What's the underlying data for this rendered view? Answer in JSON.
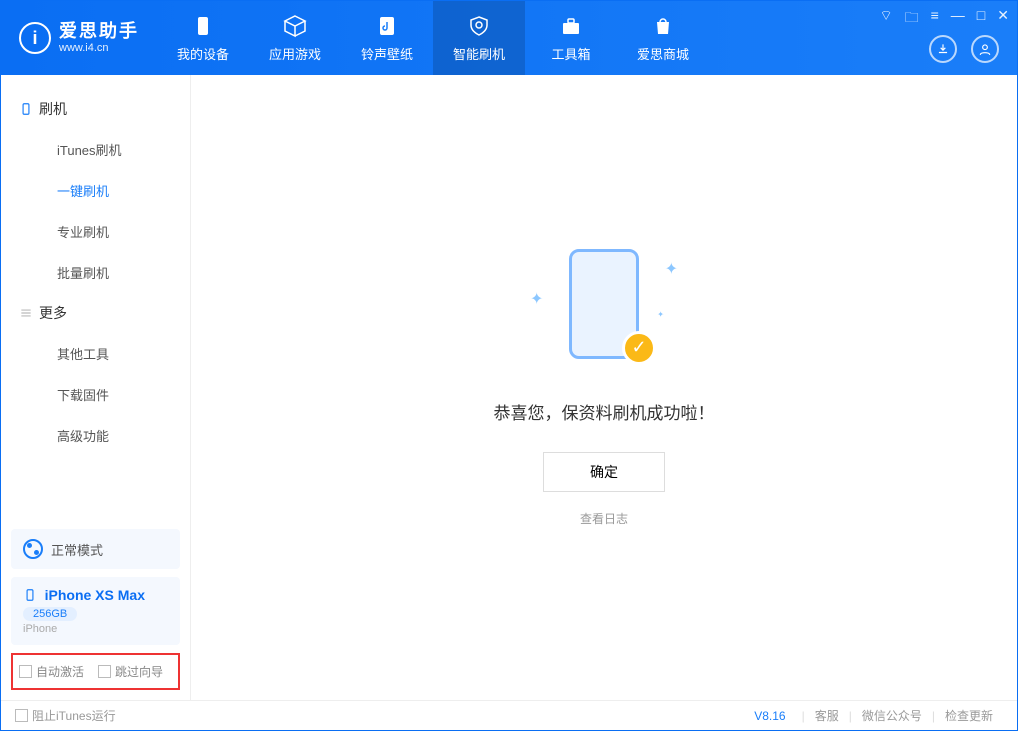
{
  "app": {
    "title": "爱思助手",
    "subtitle": "www.i4.cn"
  },
  "nav": {
    "items": [
      "我的设备",
      "应用游戏",
      "铃声壁纸",
      "智能刷机",
      "工具箱",
      "爱思商城"
    ],
    "active_index": 3
  },
  "sidebar": {
    "group_flash": "刷机",
    "flash_items": [
      "iTunes刷机",
      "一键刷机",
      "专业刷机",
      "批量刷机"
    ],
    "flash_active": 1,
    "group_more": "更多",
    "more_items": [
      "其他工具",
      "下载固件",
      "高级功能"
    ],
    "mode_label": "正常模式",
    "device_name": "iPhone XS Max",
    "device_storage": "256GB",
    "device_type": "iPhone",
    "chk_auto_activate": "自动激活",
    "chk_skip_guide": "跳过向导"
  },
  "main": {
    "success_msg": "恭喜您，保资料刷机成功啦！",
    "ok_label": "确定",
    "log_link": "查看日志"
  },
  "footer": {
    "block_itunes": "阻止iTunes运行",
    "version": "V8.16",
    "links": [
      "客服",
      "微信公众号",
      "检查更新"
    ]
  }
}
